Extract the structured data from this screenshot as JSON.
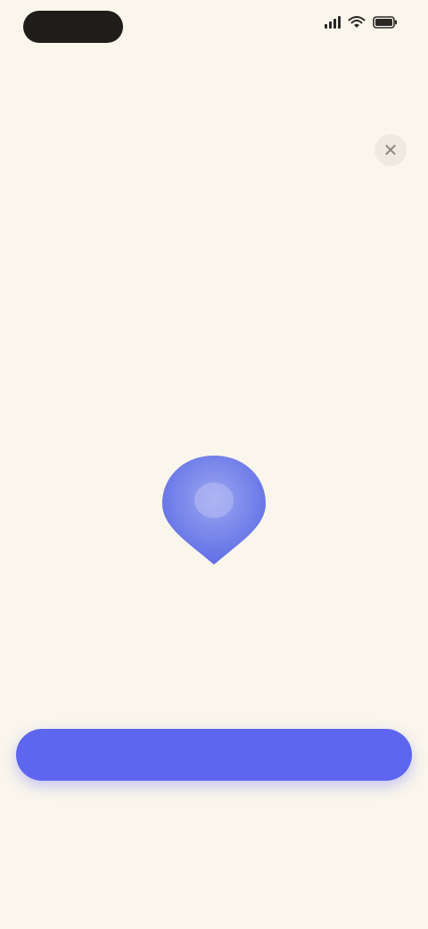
{
  "status_bar": {
    "time": "",
    "icons": [
      "signal-icon",
      "wifi-icon",
      "battery-icon"
    ]
  },
  "dialog": {
    "close_icon": "close-icon",
    "headline": "",
    "subtext": "",
    "illustration_icon": "location-pin-icon"
  },
  "actions": {
    "primary_label": "",
    "secondary_label": "",
    "footnote": ""
  },
  "colors": {
    "background": "#FAF6EC",
    "primary": "#5E66F0",
    "text": "#3A3632"
  }
}
